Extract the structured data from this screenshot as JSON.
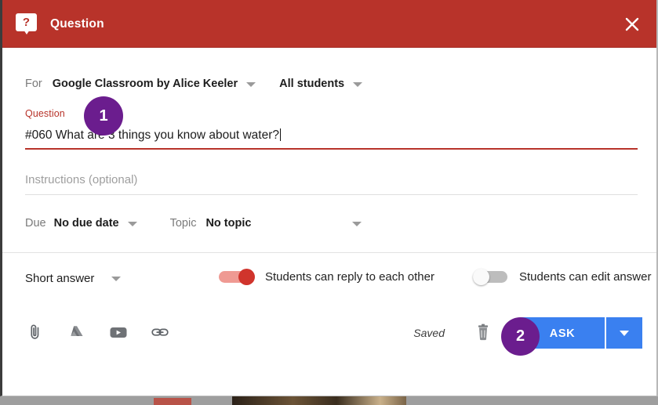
{
  "header": {
    "title": "Question",
    "icon": "question-bubble-icon",
    "close_icon": "close-icon",
    "bg_color": "#b8332a"
  },
  "form": {
    "for_label": "For",
    "class_name": "Google Classroom by Alice Keeler",
    "audience": "All students",
    "question_label": "Question",
    "question_value": "#060 What are 3 things you know about water?",
    "instructions_placeholder": "Instructions (optional)",
    "instructions_value": "",
    "due_label": "Due",
    "due_value": "No due date",
    "topic_label": "Topic",
    "topic_value": "No topic"
  },
  "options": {
    "answer_type": "Short answer",
    "toggle_reply_label": "Students can reply to each other",
    "toggle_reply_state": "on",
    "toggle_edit_label": "Students can edit answer",
    "toggle_edit_state": "off"
  },
  "attachments": {
    "items": [
      {
        "icon": "paperclip-icon"
      },
      {
        "icon": "google-drive-icon"
      },
      {
        "icon": "youtube-icon"
      },
      {
        "icon": "link-icon"
      }
    ]
  },
  "actions": {
    "saved_status": "Saved",
    "delete_icon": "trash-icon",
    "ask_label": "ASK",
    "ask_dropdown_icon": "chevron-down-icon",
    "ask_color": "#3a80f0"
  },
  "annotations": {
    "badge_color": "#6b1d8e",
    "step_1": "1",
    "step_2": "2"
  }
}
